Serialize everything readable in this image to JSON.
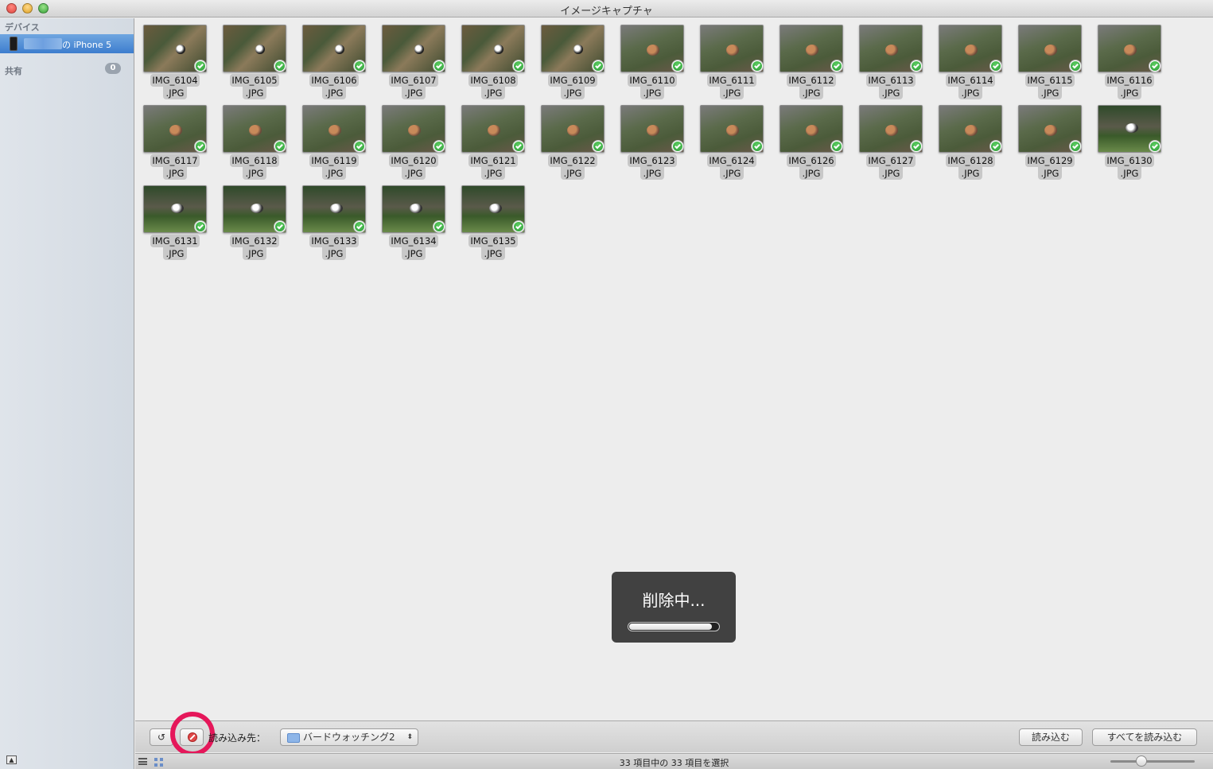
{
  "window": {
    "title": "イメージキャプチャ"
  },
  "sidebar": {
    "devices_header": "デバイス",
    "device_label": "の iPhone 5",
    "shared_header": "共有",
    "shared_count": "0"
  },
  "photos": [
    {
      "name": "IMG_6104",
      "ext": ".JPG",
      "style": "a"
    },
    {
      "name": "IMG_6105",
      "ext": ".JPG",
      "style": "a"
    },
    {
      "name": "IMG_6106",
      "ext": ".JPG",
      "style": "a"
    },
    {
      "name": "IMG_6107",
      "ext": ".JPG",
      "style": "a"
    },
    {
      "name": "IMG_6108",
      "ext": ".JPG",
      "style": "a"
    },
    {
      "name": "IMG_6109",
      "ext": ".JPG",
      "style": "a"
    },
    {
      "name": "IMG_6110",
      "ext": ".JPG",
      "style": "b"
    },
    {
      "name": "IMG_6111",
      "ext": ".JPG",
      "style": "b"
    },
    {
      "name": "IMG_6112",
      "ext": ".JPG",
      "style": "b"
    },
    {
      "name": "IMG_6113",
      "ext": ".JPG",
      "style": "b"
    },
    {
      "name": "IMG_6114",
      "ext": ".JPG",
      "style": "b"
    },
    {
      "name": "IMG_6115",
      "ext": ".JPG",
      "style": "b"
    },
    {
      "name": "IMG_6116",
      "ext": ".JPG",
      "style": "b"
    },
    {
      "name": "IMG_6117",
      "ext": ".JPG",
      "style": "b"
    },
    {
      "name": "IMG_6118",
      "ext": ".JPG",
      "style": "b"
    },
    {
      "name": "IMG_6119",
      "ext": ".JPG",
      "style": "b"
    },
    {
      "name": "IMG_6120",
      "ext": ".JPG",
      "style": "b"
    },
    {
      "name": "IMG_6121",
      "ext": ".JPG",
      "style": "b"
    },
    {
      "name": "IMG_6122",
      "ext": ".JPG",
      "style": "b"
    },
    {
      "name": "IMG_6123",
      "ext": ".JPG",
      "style": "b"
    },
    {
      "name": "IMG_6124",
      "ext": ".JPG",
      "style": "b"
    },
    {
      "name": "IMG_6126",
      "ext": ".JPG",
      "style": "b"
    },
    {
      "name": "IMG_6127",
      "ext": ".JPG",
      "style": "b"
    },
    {
      "name": "IMG_6128",
      "ext": ".JPG",
      "style": "b"
    },
    {
      "name": "IMG_6129",
      "ext": ".JPG",
      "style": "b"
    },
    {
      "name": "IMG_6130",
      "ext": ".JPG",
      "style": "c"
    },
    {
      "name": "IMG_6131",
      "ext": ".JPG",
      "style": "c"
    },
    {
      "name": "IMG_6132",
      "ext": ".JPG",
      "style": "c"
    },
    {
      "name": "IMG_6133",
      "ext": ".JPG",
      "style": "c"
    },
    {
      "name": "IMG_6134",
      "ext": ".JPG",
      "style": "c"
    },
    {
      "name": "IMG_6135",
      "ext": ".JPG",
      "style": "c"
    }
  ],
  "hud": {
    "text": "削除中...",
    "progress": 0.93
  },
  "toolbar": {
    "destination_label": "読み込み先：",
    "destination_value": "バードウォッチング2",
    "import_label": "読み込む",
    "import_all_label": "すべてを読み込む"
  },
  "status": {
    "text": "33 項目中の 33 項目を選択"
  },
  "colors": {
    "highlight_ring": "#e5175a",
    "selection": "#3d7dce",
    "check": "#2a9a35"
  }
}
